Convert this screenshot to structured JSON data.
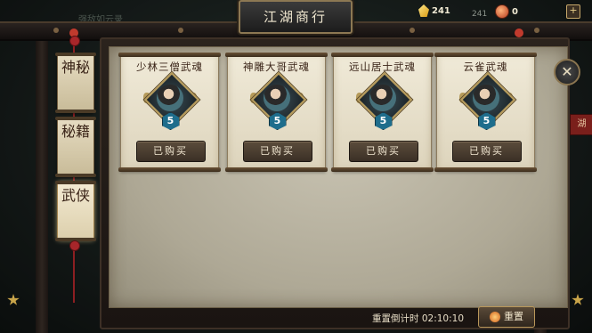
{
  "header": {
    "title": "江湖商行",
    "faded_text": "强敌如云录"
  },
  "resources": {
    "gold_count": "241",
    "gold_faint": "241",
    "character_count": "0"
  },
  "tabs": [
    {
      "label": "神秘",
      "active": false
    },
    {
      "label": "秘籍",
      "active": false
    },
    {
      "label": "武侠",
      "active": true
    }
  ],
  "shop_items": [
    {
      "name": "少林三僧武魂",
      "stars": "5",
      "button": "已购买"
    },
    {
      "name": "神雕大哥武魂",
      "stars": "5",
      "button": "已购买"
    },
    {
      "name": "远山居士武魂",
      "stars": "5",
      "button": "已购买"
    },
    {
      "name": "云雀武魂",
      "stars": "5",
      "button": "已购买"
    }
  ],
  "side_banner": "湖",
  "footer": {
    "timer_label": "重置倒计时",
    "timer_value": "02:10:10",
    "reset_label": "重置"
  },
  "colors": {
    "parchment": "#c9c4b3",
    "card": "#f0ead8",
    "button": "#4a3d30",
    "badge": "#1e6d8c",
    "accent_gold": "#b59a5a"
  }
}
